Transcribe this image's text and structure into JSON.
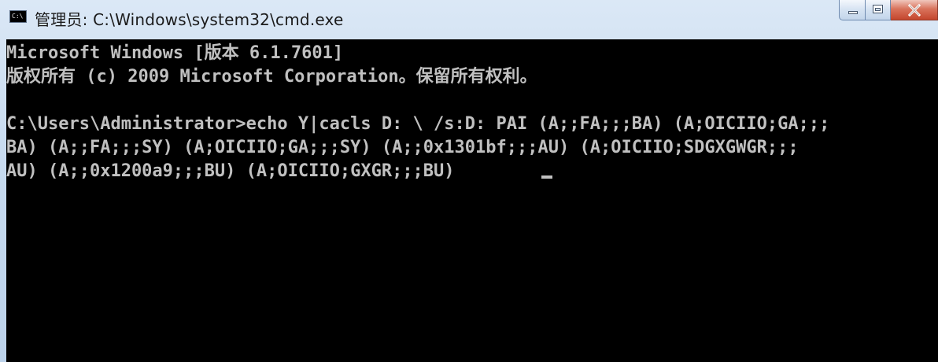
{
  "window": {
    "title": "管理员: C:\\Windows\\system32\\cmd.exe",
    "app_icon": "cmd-icon",
    "app_icon_text": "C:\\",
    "caption_buttons": [
      "minimize-icon",
      "maximize-icon",
      "close-icon"
    ]
  },
  "console": {
    "lines": [
      "Microsoft Windows [版本 6.1.7601]",
      "版权所有 (c) 2009 Microsoft Corporation。保留所有权利。",
      "",
      "C:\\Users\\Administrator>echo Y|cacls D: \\ /s:D: PAI (A;;FA;;;BA) (A;OICIIO;GA;;;",
      "BA) (A;;FA;;;SY) (A;OICIIO;GA;;;SY) (A;;0x1301bf;;;AU) (A;OICIIO;SDGXGWGR;;;",
      "AU) (A;;0x1200a9;;;BU) (A;OICIIO;GXGR;;;BU)"
    ],
    "text_color": "#c0c0c0",
    "background_color": "#000000"
  }
}
